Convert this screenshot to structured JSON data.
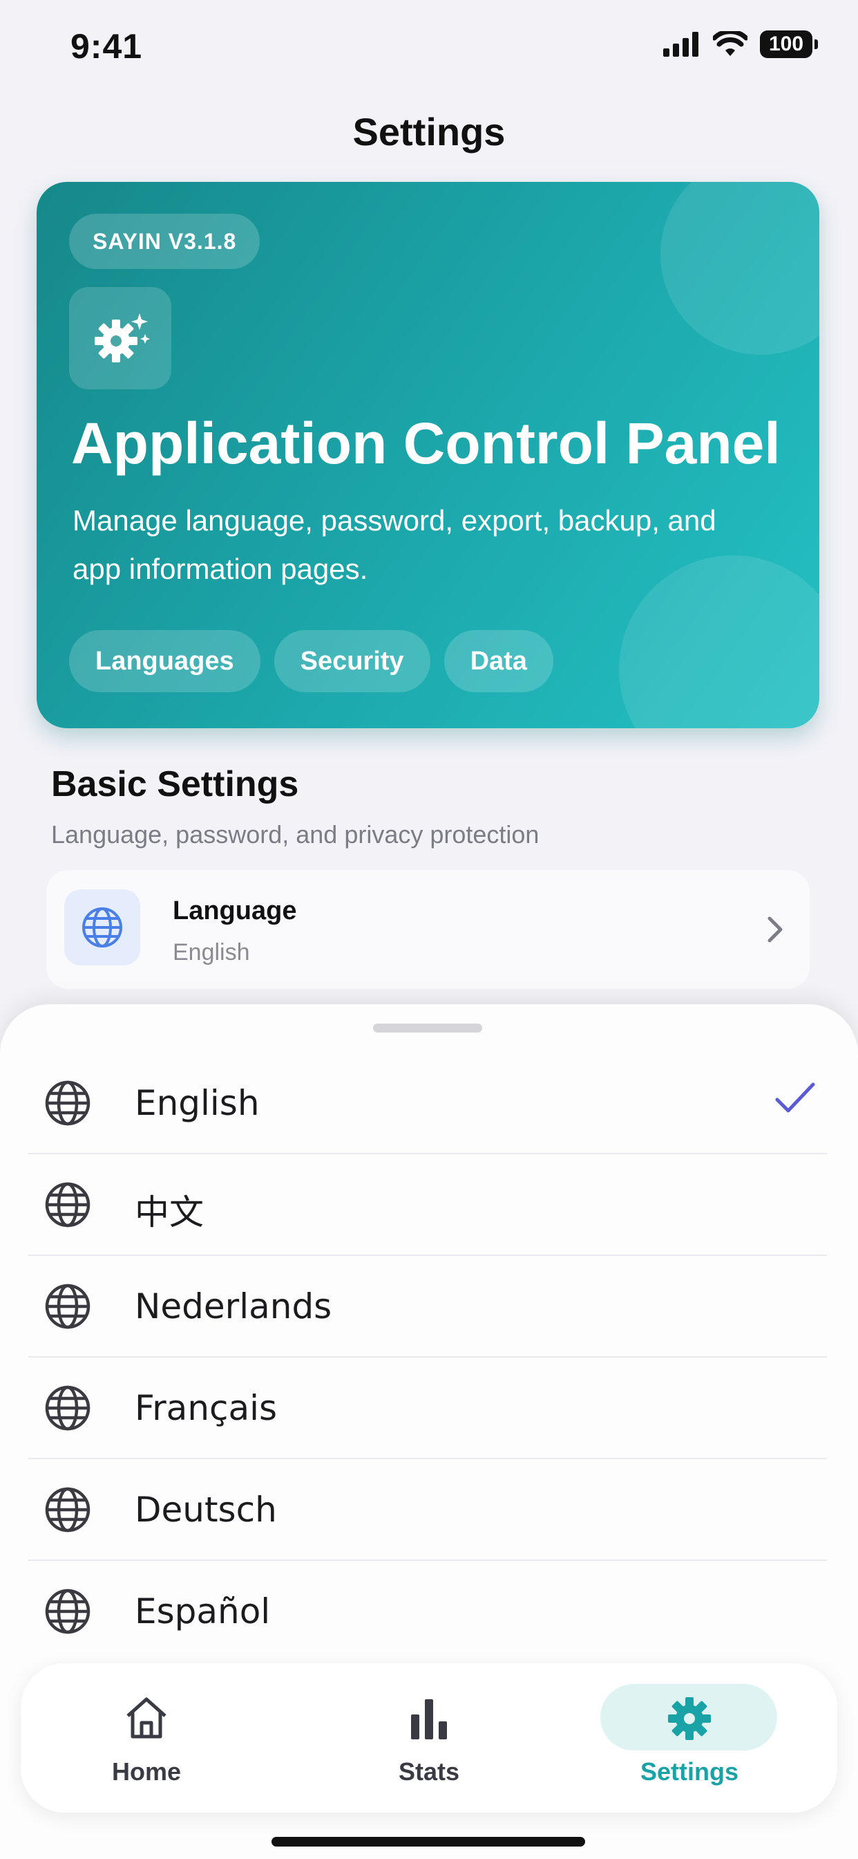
{
  "status_bar": {
    "time": "9:41",
    "battery": "100"
  },
  "nav": {
    "title": "Settings"
  },
  "hero": {
    "version": "SAYIN V3.1.8",
    "title": "Application Control Panel",
    "description": "Manage language, password, export, backup, and app information pages.",
    "chips": [
      "Languages",
      "Security",
      "Data"
    ],
    "icon": "gear-sparkle-icon"
  },
  "basic_settings": {
    "title": "Basic Settings",
    "subtitle": "Language, password, and privacy protection",
    "language_row": {
      "title": "Language",
      "value": "English",
      "icon": "globe-icon"
    }
  },
  "language_sheet": {
    "items": [
      {
        "label": "English",
        "selected": true
      },
      {
        "label": "中文",
        "selected": false
      },
      {
        "label": "Nederlands",
        "selected": false
      },
      {
        "label": "Français",
        "selected": false
      },
      {
        "label": "Deutsch",
        "selected": false
      },
      {
        "label": "Español",
        "selected": false
      }
    ]
  },
  "tab_bar": {
    "tabs": [
      {
        "label": "Home",
        "icon": "home-icon"
      },
      {
        "label": "Stats",
        "icon": "bar-chart-icon"
      },
      {
        "label": "Settings",
        "icon": "gear-icon",
        "active": true
      }
    ]
  },
  "colors": {
    "accent": "#1aa3a6",
    "check": "#5b5bd6",
    "hero_start": "#16888a",
    "hero_end": "#24c1c4"
  }
}
